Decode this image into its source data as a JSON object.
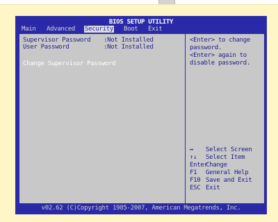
{
  "bios": {
    "title": "BIOS SETUP UTILITY",
    "menu": [
      "Main",
      "Advanced",
      "Security",
      "Boot",
      "Exit"
    ],
    "active_menu": "Security",
    "fields": [
      {
        "label": "Supervisor Password",
        "value": ":Not Installed"
      },
      {
        "label": "User Password",
        "value": ":Not Installed"
      }
    ],
    "action": "Change Supervisor Password",
    "help": [
      "<Enter> to change",
      "password.",
      "<Enter> again to",
      "disable password."
    ],
    "legend": [
      {
        "key": "↔",
        "desc": "Select Screen"
      },
      {
        "key": "↑↓",
        "desc": "Select Item"
      },
      {
        "key": "Enter",
        "desc": "Change"
      },
      {
        "key": "F1",
        "desc": "General Help"
      },
      {
        "key": "F10",
        "desc": "Save and Exit"
      },
      {
        "key": "ESC",
        "desc": "Exit"
      }
    ],
    "footer": "v02.62 (C)Copyright 1985-2007, American Megatrends, Inc."
  },
  "colors": {
    "screen_bg": "#2a2aa8",
    "panel_bg": "#c8c8c8",
    "frame_bg": "#fff6c8",
    "highlight_text": "#ffffff"
  }
}
